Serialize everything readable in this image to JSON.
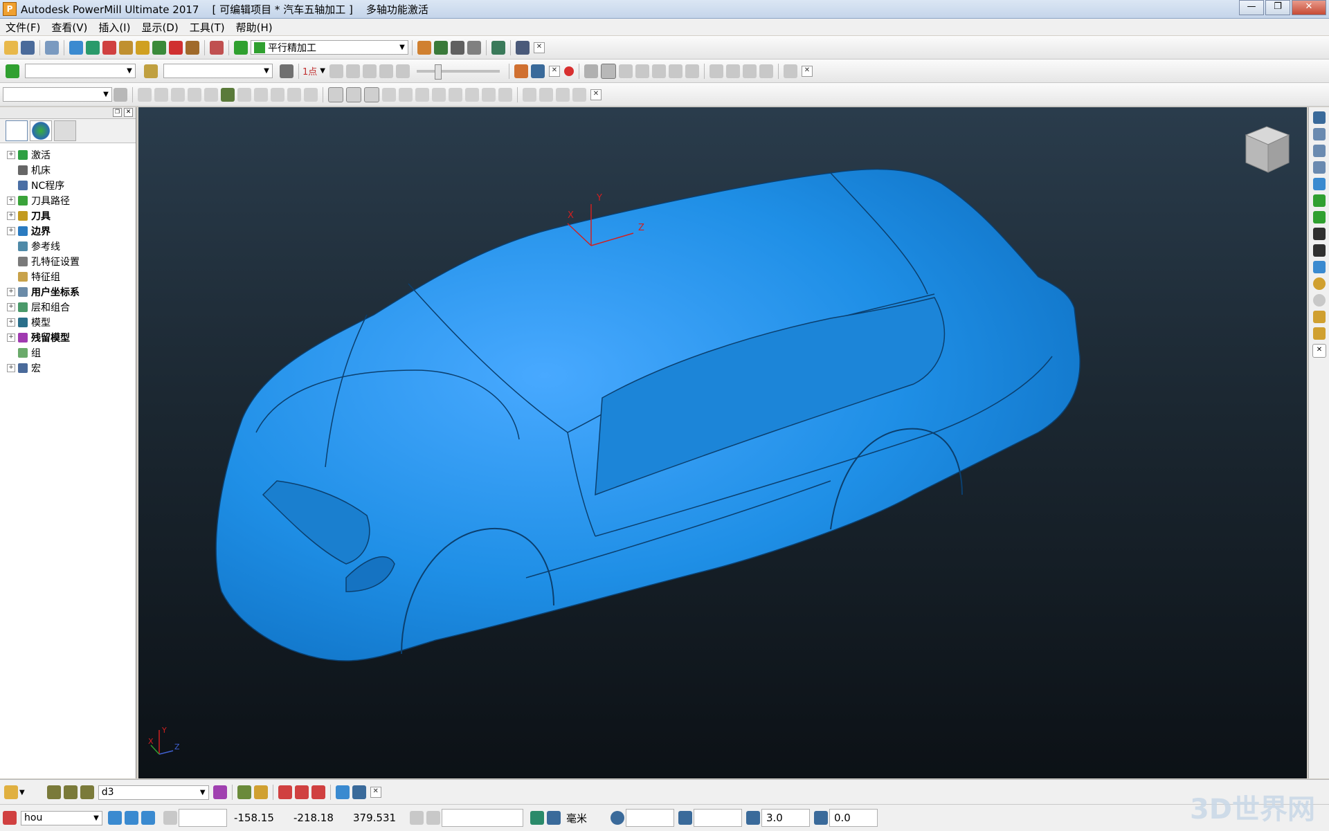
{
  "window": {
    "title": "Autodesk PowerMill Ultimate 2017    [ 可编辑项目 * 汽车五轴加工 ]    多轴功能激活",
    "app_icon": "P",
    "buttons": [
      "—",
      "❐",
      "✕"
    ]
  },
  "menu": [
    "文件(F)",
    "查看(V)",
    "插入(I)",
    "显示(D)",
    "工具(T)",
    "帮助(H)"
  ],
  "toolbar1": {
    "strategy_combo": "平行精加工"
  },
  "toolbar2": {
    "combo1": "",
    "combo2": "",
    "point_label": "1点"
  },
  "toolbar3": {
    "combo": ""
  },
  "explorer": {
    "items": [
      {
        "label": "激活",
        "bold": false,
        "expander": true,
        "color": "#2ea043"
      },
      {
        "label": "机床",
        "bold": false,
        "expander": false,
        "color": "#666666"
      },
      {
        "label": "NC程序",
        "bold": false,
        "expander": false,
        "color": "#4a6fa5"
      },
      {
        "label": "刀具路径",
        "bold": false,
        "expander": true,
        "color": "#3aa33a"
      },
      {
        "label": "刀具",
        "bold": true,
        "expander": true,
        "color": "#c29a1f"
      },
      {
        "label": "边界",
        "bold": true,
        "expander": true,
        "color": "#2b7bc0"
      },
      {
        "label": "参考线",
        "bold": false,
        "expander": false,
        "color": "#4f8aa8"
      },
      {
        "label": "孔特征设置",
        "bold": false,
        "expander": false,
        "color": "#7a7a7a"
      },
      {
        "label": "特征组",
        "bold": false,
        "expander": false,
        "color": "#c8a24a"
      },
      {
        "label": "用户坐标系",
        "bold": true,
        "expander": true,
        "color": "#6b8ba8"
      },
      {
        "label": "层和组合",
        "bold": false,
        "expander": true,
        "color": "#4a9a6a"
      },
      {
        "label": "模型",
        "bold": false,
        "expander": true,
        "color": "#2a6f8a"
      },
      {
        "label": "残留模型",
        "bold": true,
        "expander": true,
        "color": "#a03ab0"
      },
      {
        "label": "组",
        "bold": false,
        "expander": false,
        "color": "#6aaa6a"
      },
      {
        "label": "宏",
        "bold": false,
        "expander": true,
        "color": "#4a6a9a"
      }
    ]
  },
  "viewport": {
    "model_color": "#1e90e0",
    "axis": {
      "x": "X",
      "y": "Y",
      "z": "Z"
    },
    "corner_axis": {
      "x": "X",
      "y": "Y",
      "z": "Z"
    }
  },
  "statusbar1": {
    "toolpath_combo": "d3"
  },
  "statusbar2": {
    "workplane_combo": "hou",
    "coord_x": "-158.15",
    "coord_y": "-218.18",
    "coord_z": "379.531",
    "units": "毫米",
    "diameter": "3.0",
    "angle": "0.0"
  },
  "watermark": "3D世界网"
}
